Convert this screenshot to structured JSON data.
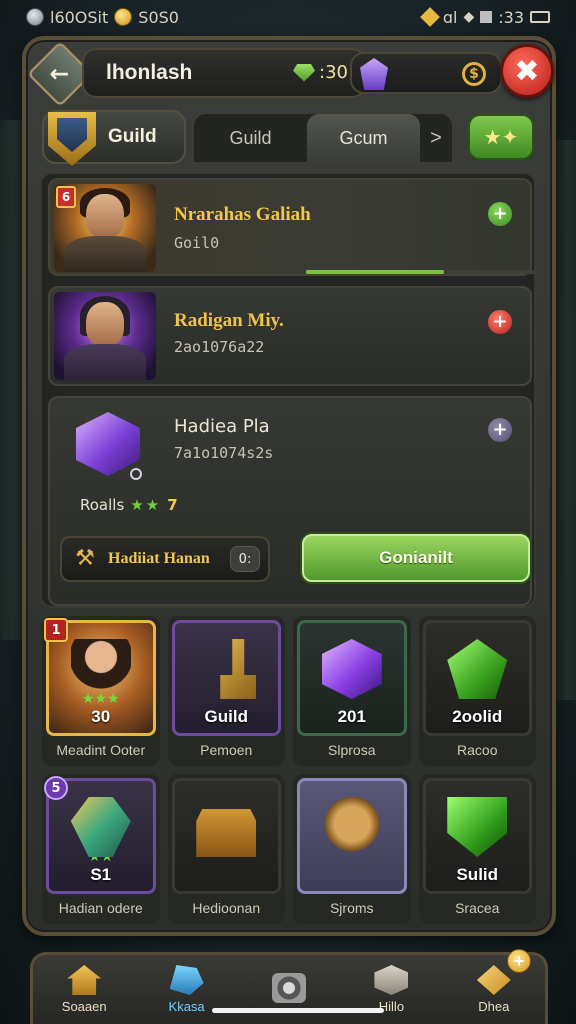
{
  "status_bar": {
    "left_text": "l60OSit",
    "left_value": "S0S0",
    "right_a": "ɑl",
    "right_b": ":33"
  },
  "header": {
    "title": "lhonlash",
    "gems": ":30",
    "coin_symbol": "$"
  },
  "tabs": {
    "badge_label": "Guild",
    "items": [
      {
        "label": "Guild",
        "selected": false
      },
      {
        "label": "Gcum",
        "selected": true
      },
      {
        "label": ">",
        "selected": false
      }
    ]
  },
  "members": [
    {
      "name": "Nrarahas Galiah",
      "sub": "Goil0",
      "level": "6",
      "action": "+",
      "progress_fraction": 0.6
    },
    {
      "name": "Radigan Miy.",
      "sub": "2ao1076a22",
      "action": "+"
    },
    {
      "name": "Hadiea Pla",
      "sub": "7a1o1074s2s",
      "action": "+",
      "rating_label": "Roalls",
      "rating_stars": "★★",
      "rating_num": "7"
    }
  ],
  "ticket": {
    "label": "Hadiiat Hanan",
    "badge": "0:"
  },
  "confirm_label": "Gonianilt",
  "grid": [
    {
      "label": "Meadint Ooter",
      "value": "30",
      "stars": "★★★",
      "tag": "1",
      "style": "gold",
      "art": "hero"
    },
    {
      "label": "Pemoen",
      "value": "Guild",
      "stars": "",
      "tag": "",
      "style": "purple-light",
      "art": "key"
    },
    {
      "label": "Slprosa",
      "value": "201",
      "stars": "",
      "tag": "",
      "style": "teal",
      "art": "pcube"
    },
    {
      "label": "Racoo",
      "value": "2oolid",
      "stars": "",
      "tag": "",
      "style": "dark",
      "art": "gem"
    },
    {
      "label": "Hadian odere",
      "value": "S1",
      "stars": "★★",
      "tag": "5",
      "style": "purple-light",
      "art": "relic"
    },
    {
      "label": "Hedioonan",
      "value": "",
      "stars": "",
      "tag": "",
      "style": "dark",
      "art": "chest"
    },
    {
      "label": "Sjroms",
      "value": "",
      "stars": "",
      "tag": "",
      "style": "lav",
      "art": "beast"
    },
    {
      "label": "Sracea",
      "value": "Sulid",
      "stars": "",
      "tag": "",
      "style": "dark",
      "art": "shield-gem"
    }
  ],
  "nav": [
    {
      "label": "Soaaen",
      "icon": "home"
    },
    {
      "label": "Kkasa",
      "icon": "heroes"
    },
    {
      "label": "",
      "icon": "camera"
    },
    {
      "label": "Hillo",
      "icon": "info"
    },
    {
      "label": "Dhea",
      "icon": "shop"
    }
  ]
}
